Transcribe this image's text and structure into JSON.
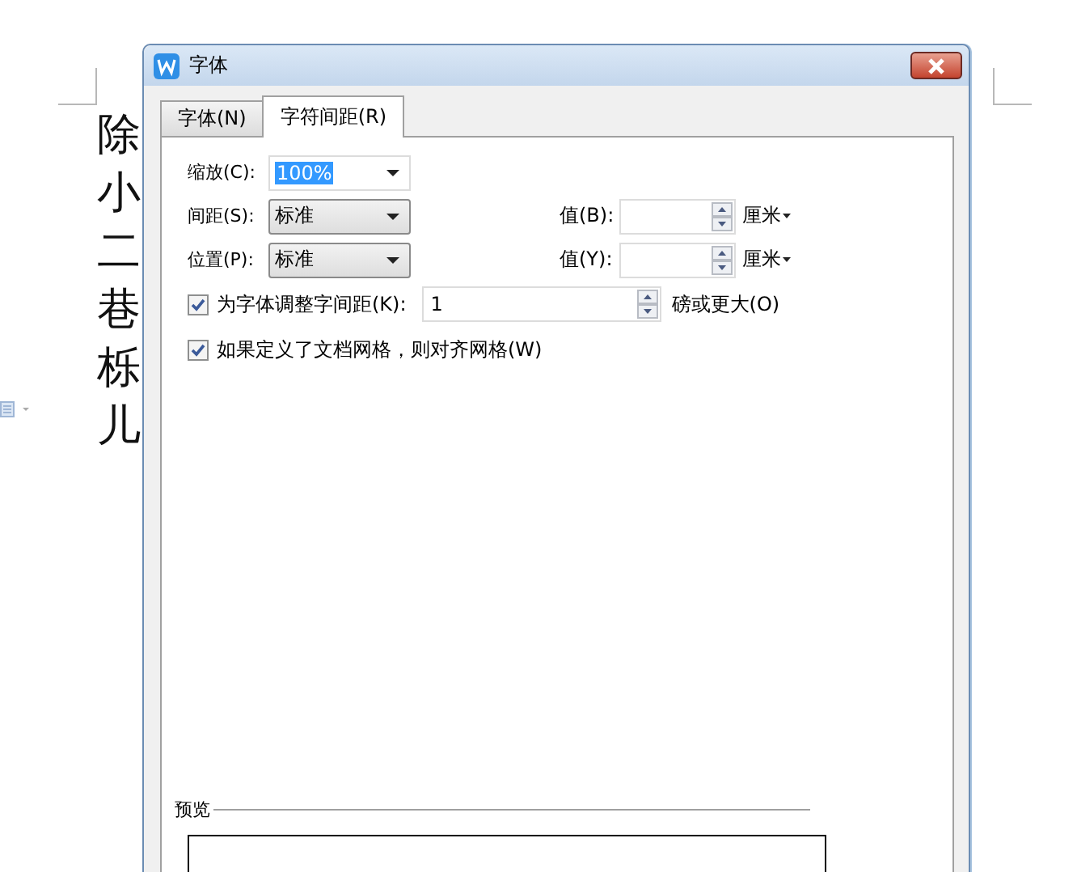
{
  "document": {
    "lines": [
      "除",
      "小",
      "二",
      "巷",
      "栎",
      "儿"
    ]
  },
  "dialog": {
    "title": "字体",
    "tabs": [
      {
        "label": "字体(N)",
        "selected": false
      },
      {
        "label": "字符间距(R)",
        "selected": true
      }
    ],
    "scale": {
      "label": "缩放(C):",
      "value": "100%"
    },
    "rows": [
      {
        "label": "间距(S):",
        "value": "标准",
        "value_label": "值(B):",
        "unit": "厘米"
      },
      {
        "label": "位置(P):",
        "value": "标准",
        "value_label": "值(Y):",
        "unit": "厘米"
      }
    ],
    "options": [
      {
        "kind": "with-field",
        "label": "为字体调整字间距(K):",
        "checked": true,
        "value": "1",
        "suffix": "磅或更大(O)"
      },
      {
        "kind": "plain",
        "label": "如果定义了文档网格，则对齐网格(W)",
        "checked": true
      }
    ],
    "preview": {
      "label": "预览"
    }
  }
}
